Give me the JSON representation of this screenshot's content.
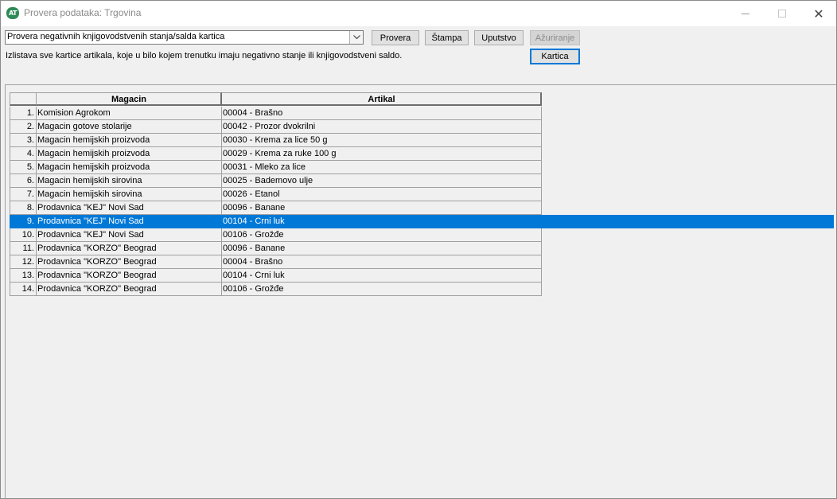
{
  "window": {
    "title": "Provera podataka: Trgovina",
    "app_icon_text": "AT"
  },
  "toolbar": {
    "check_type_value": "Provera negativnih knjigovodstvenih stanja/salda kartica",
    "provera_label": "Provera",
    "stampa_label": "Štampa",
    "uputstvo_label": "Uputstvo",
    "azuriranje_label": "Ažuriranje",
    "kartica_label": "Kartica",
    "description": "Izlistava sve kartice artikala, koje u bilo kojem trenutku imaju negativno stanje ili knjigovodstveni saldo."
  },
  "table": {
    "columns": [
      "",
      "Magacin",
      "Artikal"
    ],
    "selected_row": 9,
    "rows": [
      {
        "idx": "1.",
        "magacin": "Komision Agrokom",
        "artikal": "00004 - Brašno"
      },
      {
        "idx": "2.",
        "magacin": "Magacin gotove stolarije",
        "artikal": "00042 - Prozor dvokrilni"
      },
      {
        "idx": "3.",
        "magacin": "Magacin hemijskih proizvoda",
        "artikal": "00030 - Krema za lice 50 g"
      },
      {
        "idx": "4.",
        "magacin": "Magacin hemijskih proizvoda",
        "artikal": "00029 - Krema za ruke 100 g"
      },
      {
        "idx": "5.",
        "magacin": "Magacin hemijskih proizvoda",
        "artikal": "00031 - Mleko za lice"
      },
      {
        "idx": "6.",
        "magacin": "Magacin hemijskih sirovina",
        "artikal": "00025 - Bademovo ulje"
      },
      {
        "idx": "7.",
        "magacin": "Magacin hemijskih sirovina",
        "artikal": "00026 - Etanol"
      },
      {
        "idx": "8.",
        "magacin": "Prodavnica \"KEJ\" Novi Sad",
        "artikal": "00096 - Banane"
      },
      {
        "idx": "9.",
        "magacin": "Prodavnica \"KEJ\" Novi Sad",
        "artikal": "00104 - Crni luk"
      },
      {
        "idx": "10.",
        "magacin": "Prodavnica \"KEJ\" Novi Sad",
        "artikal": "00106 - Grožđe"
      },
      {
        "idx": "11.",
        "magacin": "Prodavnica \"KORZO\" Beograd",
        "artikal": "00096 - Banane"
      },
      {
        "idx": "12.",
        "magacin": "Prodavnica \"KORZO\" Beograd",
        "artikal": "00004 - Brašno"
      },
      {
        "idx": "13.",
        "magacin": "Prodavnica \"KORZO\" Beograd",
        "artikal": "00104 - Crni luk"
      },
      {
        "idx": "14.",
        "magacin": "Prodavnica \"KORZO\" Beograd",
        "artikal": "00106 - Grožđe"
      }
    ]
  },
  "colors": {
    "selection": "#0078d7",
    "app_icon": "#2e8b57"
  }
}
